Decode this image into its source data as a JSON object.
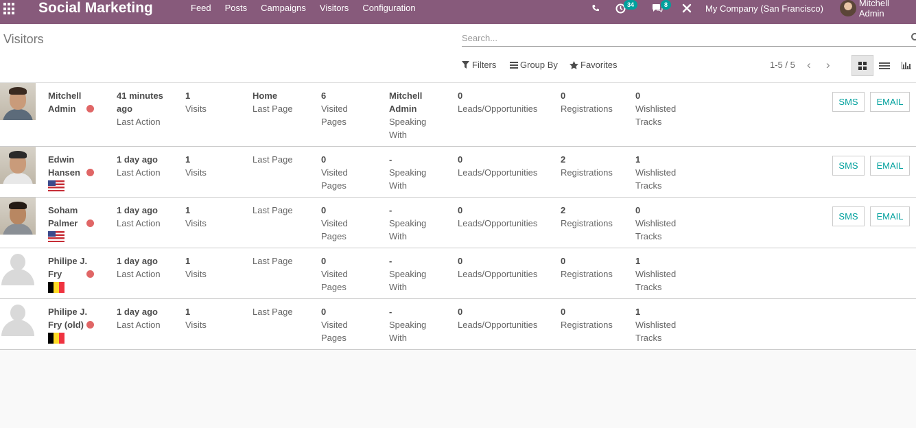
{
  "navbar": {
    "app_name": "Social Marketing",
    "menu": [
      "Feed",
      "Posts",
      "Campaigns",
      "Visitors",
      "Configuration"
    ],
    "activity_badge": "34",
    "chat_badge": "8",
    "company": "My Company (San Francisco)",
    "user": "Mitchell Admin",
    "icons": [
      "apps-icon",
      "phone-icon",
      "activity-icon",
      "chat-icon",
      "tools-icon"
    ],
    "background": "#875a7b"
  },
  "control": {
    "title": "Visitors",
    "search_placeholder": "Search...",
    "filters": "Filters",
    "group_by": "Group By",
    "favorites": "Favorites",
    "pager": "1-5 / 5"
  },
  "labels": {
    "last_action": "Last Action",
    "visits": "Visits",
    "last_page": "Last Page",
    "visited": "Visited",
    "pages": "Pages",
    "speaking": "Speaking",
    "with": "With",
    "leads": "Leads/Opportunities",
    "registrations": "Registrations",
    "wishlisted": "Wishlisted",
    "tracks": "Tracks",
    "sms": "SMS",
    "email": "EMAIL"
  },
  "visitors": [
    {
      "name_1": "Mitchell",
      "name_2": "Admin",
      "action_1": "41 minutes",
      "action_2": "ago",
      "visits": "1",
      "page": "Home",
      "visited": "6",
      "speak_1": "Mitchell",
      "speak_2": "Admin",
      "leads": "0",
      "registrations": "0",
      "wishlisted": "0",
      "flag": "",
      "photo": "person"
    },
    {
      "name_1": "Edwin",
      "name_2": "Hansen",
      "action_1": "1 day ago",
      "action_2": "",
      "visits": "1",
      "page": "",
      "visited": "0",
      "speak_1": "-",
      "speak_2": "",
      "leads": "0",
      "registrations": "2",
      "wishlisted": "1",
      "flag": "us",
      "photo": "person"
    },
    {
      "name_1": "Soham",
      "name_2": "Palmer",
      "action_1": "1 day ago",
      "action_2": "",
      "visits": "1",
      "page": "",
      "visited": "0",
      "speak_1": "-",
      "speak_2": "",
      "leads": "0",
      "registrations": "2",
      "wishlisted": "0",
      "flag": "us",
      "photo": "person"
    },
    {
      "name_1": "Philipe J.",
      "name_2": "Fry",
      "action_1": "1 day ago",
      "action_2": "",
      "visits": "1",
      "page": "",
      "visited": "0",
      "speak_1": "-",
      "speak_2": "",
      "leads": "0",
      "registrations": "0",
      "wishlisted": "1",
      "flag": "be",
      "photo": "placeholder"
    },
    {
      "name_1": "Philipe J.",
      "name_2": "Fry (old)",
      "action_1": "1 day ago",
      "action_2": "",
      "visits": "1",
      "page": "",
      "visited": "0",
      "speak_1": "-",
      "speak_2": "",
      "leads": "0",
      "registrations": "0",
      "wishlisted": "1",
      "flag": "be",
      "photo": "placeholder"
    }
  ],
  "colors": {
    "accent": "#00a09d",
    "status_dot": "#e06666",
    "flag_be": [
      "#000000",
      "#fdda24",
      "#ef3340"
    ]
  }
}
